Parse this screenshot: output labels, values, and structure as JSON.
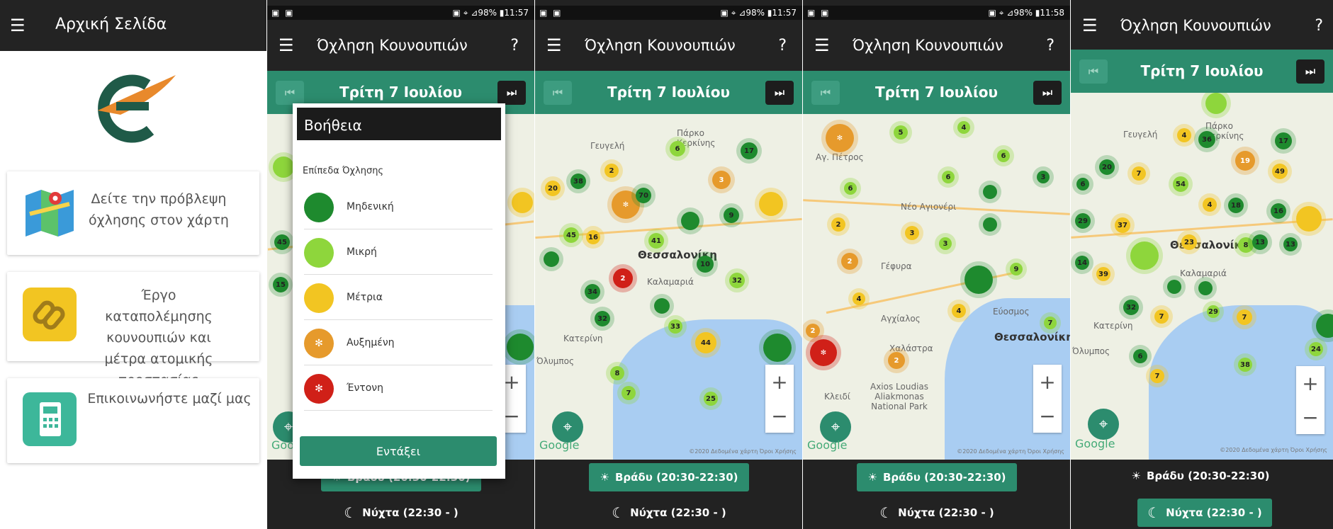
{
  "home": {
    "title": "Αρχική Σελίδα",
    "menu_icon": "hamburger-icon",
    "cards": [
      {
        "text": "Δείτε την πρόβλεψη όχλησης στον χάρτη",
        "icon": "map-icon"
      },
      {
        "text": "Έργο καταπολέμησης κουνουπιών και μέτρα ατομικής προστασίας",
        "icon": "link-icon"
      },
      {
        "text": "Επικοινωνήστε μαζί μας",
        "icon": "phone-icon"
      }
    ]
  },
  "status": {
    "s2": {
      "left": "▣ ▣",
      "right": "▣ ⌖ ⊿98% ▮11:57"
    },
    "s3": {
      "left": "▣ ▣",
      "right": "▣ ⌖ ⊿98% ▮11:57"
    },
    "s4": {
      "left": "▣ ▣",
      "right": "▣ ⌖ ⊿98% ▮11:58"
    }
  },
  "map_screen": {
    "title": "Όχληση Κουνουπιών",
    "help": "?",
    "date": "Τρίτη 7 Ιουλίου",
    "time_evening": "Βράδυ (20:30-22:30)",
    "time_night": "Νύχτα (22:30 - )",
    "google": "Google",
    "attribution": "©2020 Δεδομένα χάρτη  Όροι Χρήσης",
    "zoom_in": "+",
    "zoom_out": "−"
  },
  "help_dialog": {
    "title": "Βοήθεια",
    "subtitle": "Επίπεδα Όχλησης",
    "levels": [
      {
        "label": "Μηδενική",
        "color": "#1e8a2e"
      },
      {
        "label": "Μικρή",
        "color": "#8ed63c"
      },
      {
        "label": "Μέτρια",
        "color": "#f2c522"
      },
      {
        "label": "Αυξημένη",
        "color": "#e69a2c"
      },
      {
        "label": "Έντονη",
        "color": "#d02018"
      }
    ],
    "ok": "Εντάξει"
  },
  "map_labels": {
    "s2": [
      "Θεσσαλονίκη",
      "Καλαμαριά",
      "Όλυμπος"
    ],
    "s3": [
      "Γευγελή",
      "Πάρκο Κερκίνης",
      "Θεσσαλονίκη",
      "Καλαμαριά",
      "Κατερίνη",
      "Όλυμπος"
    ],
    "s4": [
      "Νέο Αγιονέρι",
      "Αγ. Πέτρος",
      "Γέφυρα",
      "Αγχίαλος",
      "Χαλάστρα",
      "Εύοσμος",
      "Θεσσαλονίκη",
      "Κλειδί",
      "Axios Loudias Aliakmonas National Park"
    ],
    "s5": [
      "Γευγελή",
      "Πάρκο Κερκίνης",
      "Θεσσαλονίκη",
      "Καλαμαριά",
      "Κατερίνη",
      "Όλυμπος"
    ]
  }
}
